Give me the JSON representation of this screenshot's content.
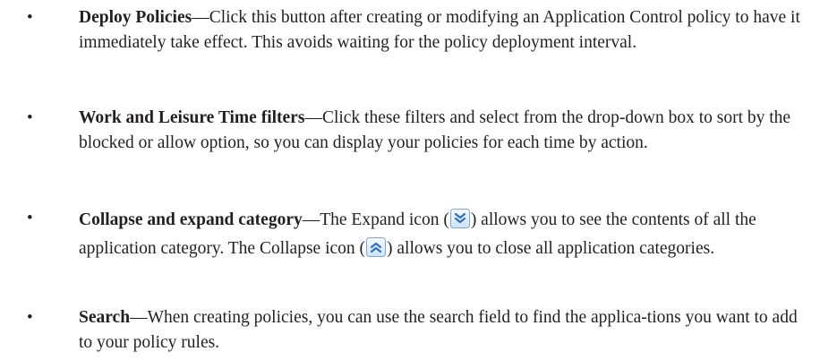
{
  "bullets": [
    {
      "bullet": "•",
      "term": "Deploy Policies",
      "dash": "—",
      "text": "Click this button after creating or modifying an Application Control policy to have it immediately take effect. This avoids waiting for the policy deployment interval."
    },
    {
      "bullet": "•",
      "term": "Work and Leisure Time filters",
      "dash": "—",
      "text": "Click these filters and select from the drop-down box to sort by the blocked or allow option, so you can display your policies for each time by action."
    },
    {
      "bullet": "•",
      "term": "Collapse and expand category",
      "dash": "—",
      "text_a": "The Expand icon (",
      "expand_icon": "chevron-double-down-icon",
      "text_b": ") allows you to see the contents of all the application category. The Collapse icon (",
      "collapse_icon": "chevron-double-up-icon",
      "text_c": ") allows you to close all application categories."
    },
    {
      "bullet": "•",
      "term": "Search",
      "dash": "—",
      "text": "When creating policies, you can use the search field to find the applica-tions you want to add to your policy rules."
    }
  ],
  "colors": {
    "text": "#231f20",
    "icon_border": "#7aa7d8",
    "icon_fill_top": "#f4f9ff",
    "icon_fill_bottom": "#cfe3f8",
    "icon_chevron": "#2f6fc0"
  }
}
